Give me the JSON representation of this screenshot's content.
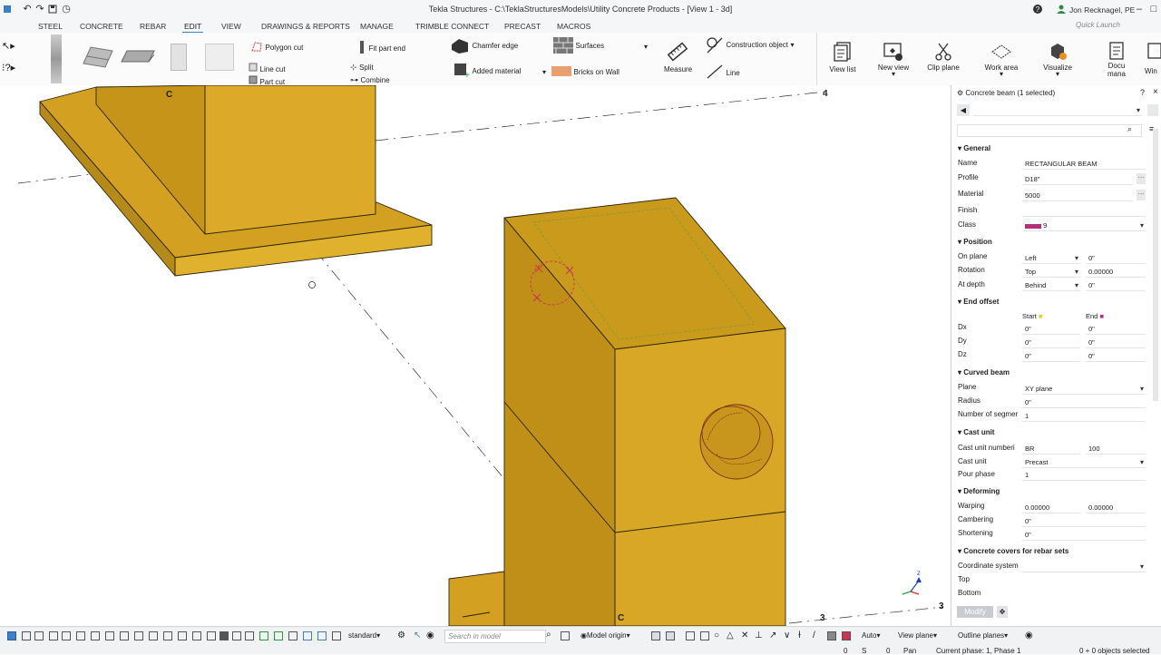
{
  "window": {
    "title": "Tekla Structures - C:\\TeklaStructuresModels\\Utility Concrete Products  - [View 1 - 3d]",
    "user": "Jon Recknagel, PE",
    "quick_launch_placeholder": "Quick Launch"
  },
  "menu": [
    "STEEL",
    "CONCRETE",
    "REBAR",
    "EDIT",
    "VIEW",
    "DRAWINGS & REPORTS",
    "MANAGE",
    "TRIMBLE CONNECT",
    "PRECAST",
    "MACROS"
  ],
  "menu_active": "EDIT",
  "ribbon": {
    "polygon_cut": "Polygon cut",
    "line_cut": "Line cut",
    "part_cut": "Part cut",
    "fit_part_end": "Fit part end",
    "split": "Split",
    "combine": "Combine",
    "chamfer_edge": "Chamfer edge",
    "added_material": "Added material",
    "surfaces": "Surfaces",
    "bricks_on_wall": "Bricks on Wall",
    "measure": "Measure",
    "construction_object": "Construction object",
    "line": "Line",
    "view_list": "View list",
    "new_view": "New view",
    "clip_plane": "Clip plane",
    "work_area": "Work area",
    "visualize": "Visualize",
    "docu_1": "Docu",
    "docu_2": "mana",
    "win": "Win"
  },
  "viewport": {
    "grid_labels": [
      "C",
      "4",
      "C",
      "3",
      "3"
    ],
    "axis_z": "Z"
  },
  "panel": {
    "header": "Concrete beam (1 selected)",
    "sections": {
      "general": "General",
      "position": "Position",
      "end_offset": "End offset",
      "curved_beam": "Curved beam",
      "cast_unit": "Cast unit",
      "deforming": "Deforming",
      "covers": "Concrete covers for rebar sets"
    },
    "general": {
      "name_label": "Name",
      "name": "RECTANGULAR BEAM",
      "profile_label": "Profile",
      "profile": "D18\"",
      "material_label": "Material",
      "material": "5000",
      "finish_label": "Finish",
      "finish": "",
      "class_label": "Class",
      "class": "9",
      "class_color": "#b0307a"
    },
    "position": {
      "on_plane_label": "On plane",
      "on_plane": "Left",
      "on_plane_val": "0\"",
      "rotation_label": "Rotation",
      "rotation": "Top",
      "rotation_val": "0.00000",
      "at_depth_label": "At depth",
      "at_depth": "Behind",
      "at_depth_val": "0\""
    },
    "end_offset": {
      "start": "Start",
      "end": "End",
      "dx": "Dx",
      "dy": "Dy",
      "dz": "Dz",
      "dx_s": "0\"",
      "dx_e": "0\"",
      "dy_s": "0\"",
      "dy_e": "0\"",
      "dz_s": "0\"",
      "dz_e": "0\""
    },
    "curved_beam": {
      "plane_label": "Plane",
      "plane": "XY plane",
      "radius_label": "Radius",
      "radius": "0\"",
      "segments_label": "Number of segmer",
      "segments": "1"
    },
    "cast_unit": {
      "number_label": "Cast unit numberi",
      "prefix": "BR",
      "start_no": "100",
      "unit_label": "Cast unit",
      "unit": "Precast",
      "pour_label": "Pour phase",
      "pour": "1"
    },
    "deforming": {
      "warping_label": "Warping",
      "warp_1": "0.00000",
      "warp_2": "0.00000",
      "cambering_label": "Cambering",
      "cambering": "0\"",
      "shortening_label": "Shortening",
      "shortening": "0\""
    },
    "covers": {
      "coord_label": "Coordinate system",
      "top_label": "Top",
      "bottom_label": "Bottom"
    },
    "modify_button": "Modify"
  },
  "bottom": {
    "view_setting": "standard",
    "search_placeholder": "Search in model",
    "model_origin": "Model origin",
    "auto": "Auto",
    "view_plane": "View plane",
    "outline_planes": "Outline planes",
    "coord_o": "0",
    "coord_s": "S",
    "coord_zero": "0",
    "pan": "Pan",
    "phase": "Current phase: 1, Phase 1",
    "selected": "0 + 0 objects selected"
  },
  "colors": {
    "concrete": "#d9a52a",
    "accent": "#3b7fc4",
    "selection": "#cc3355"
  }
}
